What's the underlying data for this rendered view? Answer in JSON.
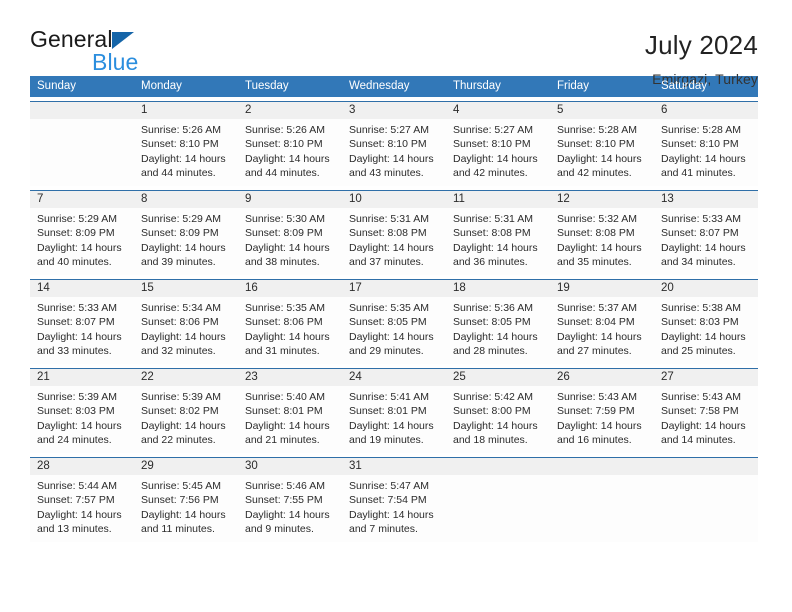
{
  "brand": {
    "name_dark": "General",
    "name_blue": "Blue",
    "accent_blue": "#2b8ede",
    "triangle_blue": "#1565a8"
  },
  "header": {
    "title": "July 2024",
    "subtitle": "Emirgazi, Turkey"
  },
  "colors": {
    "header_row_bg": "#3278b8",
    "week_top_border": "#2f6fa8",
    "day_number_band": "#f0f0f0",
    "cell_body": "#fdfdfd",
    "text": "#2b2b2b"
  },
  "weekdays": [
    "Sunday",
    "Monday",
    "Tuesday",
    "Wednesday",
    "Thursday",
    "Friday",
    "Saturday"
  ],
  "weeks": [
    [
      {
        "day": "",
        "lines": [
          "",
          "",
          "",
          ""
        ]
      },
      {
        "day": "1",
        "lines": [
          "Sunrise: 5:26 AM",
          "Sunset: 8:10 PM",
          "Daylight: 14 hours",
          "and 44 minutes."
        ]
      },
      {
        "day": "2",
        "lines": [
          "Sunrise: 5:26 AM",
          "Sunset: 8:10 PM",
          "Daylight: 14 hours",
          "and 44 minutes."
        ]
      },
      {
        "day": "3",
        "lines": [
          "Sunrise: 5:27 AM",
          "Sunset: 8:10 PM",
          "Daylight: 14 hours",
          "and 43 minutes."
        ]
      },
      {
        "day": "4",
        "lines": [
          "Sunrise: 5:27 AM",
          "Sunset: 8:10 PM",
          "Daylight: 14 hours",
          "and 42 minutes."
        ]
      },
      {
        "day": "5",
        "lines": [
          "Sunrise: 5:28 AM",
          "Sunset: 8:10 PM",
          "Daylight: 14 hours",
          "and 42 minutes."
        ]
      },
      {
        "day": "6",
        "lines": [
          "Sunrise: 5:28 AM",
          "Sunset: 8:10 PM",
          "Daylight: 14 hours",
          "and 41 minutes."
        ]
      }
    ],
    [
      {
        "day": "7",
        "lines": [
          "Sunrise: 5:29 AM",
          "Sunset: 8:09 PM",
          "Daylight: 14 hours",
          "and 40 minutes."
        ]
      },
      {
        "day": "8",
        "lines": [
          "Sunrise: 5:29 AM",
          "Sunset: 8:09 PM",
          "Daylight: 14 hours",
          "and 39 minutes."
        ]
      },
      {
        "day": "9",
        "lines": [
          "Sunrise: 5:30 AM",
          "Sunset: 8:09 PM",
          "Daylight: 14 hours",
          "and 38 minutes."
        ]
      },
      {
        "day": "10",
        "lines": [
          "Sunrise: 5:31 AM",
          "Sunset: 8:08 PM",
          "Daylight: 14 hours",
          "and 37 minutes."
        ]
      },
      {
        "day": "11",
        "lines": [
          "Sunrise: 5:31 AM",
          "Sunset: 8:08 PM",
          "Daylight: 14 hours",
          "and 36 minutes."
        ]
      },
      {
        "day": "12",
        "lines": [
          "Sunrise: 5:32 AM",
          "Sunset: 8:08 PM",
          "Daylight: 14 hours",
          "and 35 minutes."
        ]
      },
      {
        "day": "13",
        "lines": [
          "Sunrise: 5:33 AM",
          "Sunset: 8:07 PM",
          "Daylight: 14 hours",
          "and 34 minutes."
        ]
      }
    ],
    [
      {
        "day": "14",
        "lines": [
          "Sunrise: 5:33 AM",
          "Sunset: 8:07 PM",
          "Daylight: 14 hours",
          "and 33 minutes."
        ]
      },
      {
        "day": "15",
        "lines": [
          "Sunrise: 5:34 AM",
          "Sunset: 8:06 PM",
          "Daylight: 14 hours",
          "and 32 minutes."
        ]
      },
      {
        "day": "16",
        "lines": [
          "Sunrise: 5:35 AM",
          "Sunset: 8:06 PM",
          "Daylight: 14 hours",
          "and 31 minutes."
        ]
      },
      {
        "day": "17",
        "lines": [
          "Sunrise: 5:35 AM",
          "Sunset: 8:05 PM",
          "Daylight: 14 hours",
          "and 29 minutes."
        ]
      },
      {
        "day": "18",
        "lines": [
          "Sunrise: 5:36 AM",
          "Sunset: 8:05 PM",
          "Daylight: 14 hours",
          "and 28 minutes."
        ]
      },
      {
        "day": "19",
        "lines": [
          "Sunrise: 5:37 AM",
          "Sunset: 8:04 PM",
          "Daylight: 14 hours",
          "and 27 minutes."
        ]
      },
      {
        "day": "20",
        "lines": [
          "Sunrise: 5:38 AM",
          "Sunset: 8:03 PM",
          "Daylight: 14 hours",
          "and 25 minutes."
        ]
      }
    ],
    [
      {
        "day": "21",
        "lines": [
          "Sunrise: 5:39 AM",
          "Sunset: 8:03 PM",
          "Daylight: 14 hours",
          "and 24 minutes."
        ]
      },
      {
        "day": "22",
        "lines": [
          "Sunrise: 5:39 AM",
          "Sunset: 8:02 PM",
          "Daylight: 14 hours",
          "and 22 minutes."
        ]
      },
      {
        "day": "23",
        "lines": [
          "Sunrise: 5:40 AM",
          "Sunset: 8:01 PM",
          "Daylight: 14 hours",
          "and 21 minutes."
        ]
      },
      {
        "day": "24",
        "lines": [
          "Sunrise: 5:41 AM",
          "Sunset: 8:01 PM",
          "Daylight: 14 hours",
          "and 19 minutes."
        ]
      },
      {
        "day": "25",
        "lines": [
          "Sunrise: 5:42 AM",
          "Sunset: 8:00 PM",
          "Daylight: 14 hours",
          "and 18 minutes."
        ]
      },
      {
        "day": "26",
        "lines": [
          "Sunrise: 5:43 AM",
          "Sunset: 7:59 PM",
          "Daylight: 14 hours",
          "and 16 minutes."
        ]
      },
      {
        "day": "27",
        "lines": [
          "Sunrise: 5:43 AM",
          "Sunset: 7:58 PM",
          "Daylight: 14 hours",
          "and 14 minutes."
        ]
      }
    ],
    [
      {
        "day": "28",
        "lines": [
          "Sunrise: 5:44 AM",
          "Sunset: 7:57 PM",
          "Daylight: 14 hours",
          "and 13 minutes."
        ]
      },
      {
        "day": "29",
        "lines": [
          "Sunrise: 5:45 AM",
          "Sunset: 7:56 PM",
          "Daylight: 14 hours",
          "and 11 minutes."
        ]
      },
      {
        "day": "30",
        "lines": [
          "Sunrise: 5:46 AM",
          "Sunset: 7:55 PM",
          "Daylight: 14 hours",
          "and 9 minutes."
        ]
      },
      {
        "day": "31",
        "lines": [
          "Sunrise: 5:47 AM",
          "Sunset: 7:54 PM",
          "Daylight: 14 hours",
          "and 7 minutes."
        ]
      },
      {
        "day": "",
        "lines": [
          "",
          "",
          "",
          ""
        ]
      },
      {
        "day": "",
        "lines": [
          "",
          "",
          "",
          ""
        ]
      },
      {
        "day": "",
        "lines": [
          "",
          "",
          "",
          ""
        ]
      }
    ]
  ]
}
